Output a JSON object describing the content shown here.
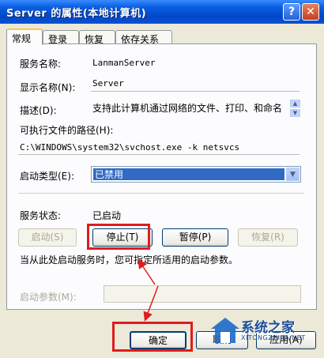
{
  "window": {
    "title": "Server 的属性(本地计算机)",
    "help_glyph": "?",
    "close_glyph": "✕"
  },
  "tabs": [
    {
      "label": "常规",
      "active": true
    },
    {
      "label": "登录",
      "active": false
    },
    {
      "label": "恢复",
      "active": false
    },
    {
      "label": "依存关系",
      "active": false
    }
  ],
  "general": {
    "service_name_label": "服务名称:",
    "service_name_value": "LanmanServer",
    "display_name_label": "显示名称(N):",
    "display_name_value": "Server",
    "description_label": "描述(D):",
    "description_value": "支持此计算机通过网络的文件、打印、和命名",
    "exe_path_label": "可执行文件的路径(H):",
    "exe_path_value": "C:\\WINDOWS\\system32\\svchost.exe -k netsvcs",
    "startup_type_label": "启动类型(E):",
    "startup_type_value": "已禁用",
    "service_status_label": "服务状态:",
    "service_status_value": "已启动",
    "start_button": "启动(S)",
    "stop_button": "停止(T)",
    "pause_button": "暂停(P)",
    "resume_button": "恢复(R)",
    "hint_text": "当从此处启动服务时，您可指定所适用的启动参数。",
    "start_params_label": "启动参数(M):",
    "start_params_value": ""
  },
  "footer": {
    "ok_button": "确定",
    "cancel_button": "取消",
    "apply_button": "应用(A)"
  },
  "watermark": {
    "brand": "系统之家",
    "url": "XITONGZHIJIA.NET"
  },
  "colors": {
    "titlebar": "#0A5FE0",
    "highlight": "#E01C1C",
    "selection": "#316AC5"
  }
}
